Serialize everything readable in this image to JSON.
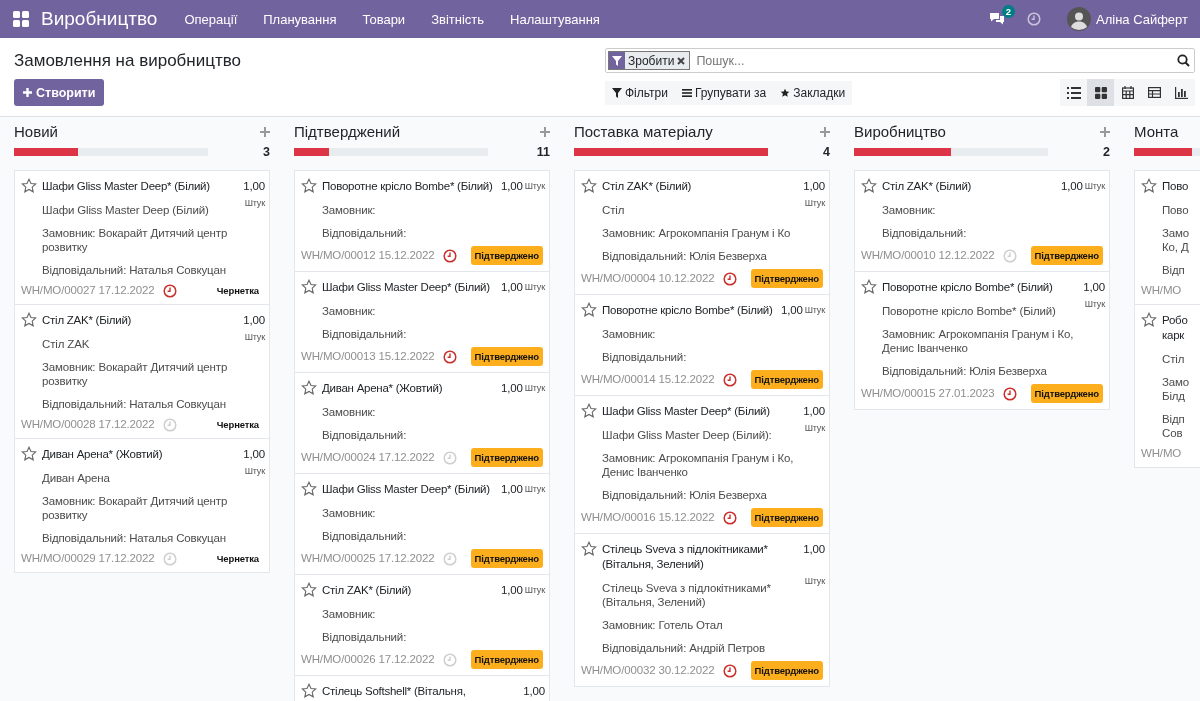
{
  "navbar": {
    "app_title": "Виробництво",
    "menu": [
      "Операції",
      "Планування",
      "Товари",
      "Звітність",
      "Налаштування"
    ],
    "messages_count": "2",
    "user_name": "Аліна Сайферт"
  },
  "control_panel": {
    "title": "Замовлення на виробництво",
    "create_button": "Створити",
    "search": {
      "facets": [
        {
          "label": "Зробити"
        }
      ],
      "placeholder": "Пошук..."
    },
    "filter_buttons": [
      {
        "kind": "filter",
        "label": "Фільтри"
      },
      {
        "kind": "group",
        "label": "Групувати за"
      },
      {
        "kind": "favorite",
        "label": "Закладки"
      }
    ],
    "views": [
      {
        "kind": "list",
        "selected": false
      },
      {
        "kind": "kanban",
        "selected": true
      },
      {
        "kind": "calendar",
        "selected": false
      },
      {
        "kind": "pivot",
        "selected": false
      },
      {
        "kind": "graph",
        "selected": false
      }
    ]
  },
  "columns": [
    {
      "title": "Новий",
      "count": "3",
      "level": 0.33,
      "cards": [
        {
          "name": "Шафи Gliss Master Deep* (Білий)",
          "quantity": "1,00",
          "uom": "Штук",
          "product": "Шафи Gliss Master Deep (Білий)",
          "customer": "Замовник: Вокарайт Дитячий центр розвитку",
          "responsible": "Відповідальний: Наталья Совкуцан",
          "reference": "WH/MO/00027 17.12.2022",
          "overdue": true,
          "status": {
            "kind": "draft",
            "label": "Чернетка"
          }
        },
        {
          "name": "Стіл ZAK* (Білий)",
          "quantity": "1,00",
          "uom": "Штук",
          "product": "Стіл ZAK",
          "customer": "Замовник: Вокарайт Дитячий центр розвитку",
          "responsible": "Відповідальний: Наталья Совкуцан",
          "reference": "WH/MO/00028 17.12.2022",
          "overdue": false,
          "status": {
            "kind": "draft",
            "label": "Чернетка"
          }
        },
        {
          "name": "Диван Арена* (Жовтий)",
          "quantity": "1,00",
          "uom": "Штук",
          "product": "Диван Арена",
          "customer": "Замовник: Вокарайт Дитячий центр розвитку",
          "responsible": "Відповідальний: Наталья Совкуцан",
          "reference": "WH/MO/00029 17.12.2022",
          "overdue": false,
          "status": {
            "kind": "draft",
            "label": "Чернетка"
          }
        }
      ]
    },
    {
      "title": "Підтверджений",
      "count": "11",
      "level": 0.18,
      "cards": [
        {
          "name": "Поворотне крісло Bombe* (Білий)",
          "quantity": "1,00",
          "uom": "Штук",
          "customer": "Замовник:",
          "responsible": "Відповідальний:",
          "reference": "WH/MO/00012 15.12.2022",
          "overdue": true,
          "status": {
            "kind": "confirmed",
            "label": "Підтверджено"
          }
        },
        {
          "name": "Шафи Gliss Master Deep* (Білий)",
          "quantity": "1,00",
          "uom": "Штук",
          "customer": "Замовник:",
          "responsible": "Відповідальний:",
          "reference": "WH/MO/00013 15.12.2022",
          "overdue": true,
          "status": {
            "kind": "confirmed",
            "label": "Підтверджено"
          }
        },
        {
          "name": "Диван Арена* (Жовтий)",
          "quantity": "1,00",
          "uom": "Штук",
          "customer": "Замовник:",
          "responsible": "Відповідальний:",
          "reference": "WH/MO/00024 17.12.2022",
          "overdue": false,
          "status": {
            "kind": "confirmed",
            "label": "Підтверджено"
          }
        },
        {
          "name": "Шафи Gliss Master Deep* (Білий)",
          "quantity": "1,00",
          "uom": "Штук",
          "customer": "Замовник:",
          "responsible": "Відповідальний:",
          "reference": "WH/MO/00025 17.12.2022",
          "overdue": false,
          "status": {
            "kind": "confirmed",
            "label": "Підтверджено"
          }
        },
        {
          "name": "Стіл ZAK* (Білий)",
          "quantity": "1,00",
          "uom": "Штук",
          "customer": "Замовник:",
          "responsible": "Відповідальний:",
          "reference": "WH/MO/00026 17.12.2022",
          "overdue": false,
          "status": {
            "kind": "confirmed",
            "label": "Підтверджено"
          }
        },
        {
          "name": "Стілець Softshell* (Вітальня,",
          "quantity": "1,00"
        }
      ]
    },
    {
      "title": "Поставка матеріалу",
      "count": "4",
      "level": 1,
      "cards": [
        {
          "name": "Стіл ZAK* (Білий)",
          "quantity": "1,00",
          "uom": "Штук",
          "product": "Стіл",
          "customer": "Замовник: Агрокомпанія Гранум і Ко",
          "responsible": "Відповідальний: Юлія Безверха",
          "reference": "WH/MO/00004 10.12.2022",
          "overdue": true,
          "status": {
            "kind": "confirmed",
            "label": "Підтверджено"
          }
        },
        {
          "name": "Поворотне крісло Bombe* (Білий)",
          "quantity": "1,00",
          "uom": "Штук",
          "customer": "Замовник:",
          "responsible": "Відповідальний:",
          "reference": "WH/MO/00014 15.12.2022",
          "overdue": true,
          "status": {
            "kind": "confirmed",
            "label": "Підтверджено"
          }
        },
        {
          "name": "Шафи Gliss Master Deep* (Білий)",
          "quantity": "1,00",
          "uom": "Штук",
          "product": "Шафи Gliss Master Deep (Білий):",
          "customer": "Замовник: Агрокомпанія Гранум і Ко, Денис Іванченко",
          "responsible": "Відповідальний: Юлія Безверха",
          "reference": "WH/MO/00016 15.12.2022",
          "overdue": true,
          "status": {
            "kind": "confirmed",
            "label": "Підтверджено"
          }
        },
        {
          "name": "Стілець Sveva з підлокітниками* (Вітальня, Зелений)",
          "quantity": "1,00",
          "uom": "Штук",
          "product": "Стілець Sveva з підлокітниками* (Вітальня, Зелений)",
          "customer": "Замовник: Готель Отал",
          "responsible": "Відповідальний: Андрій Петров",
          "reference": "WH/MO/00032 30.12.2022",
          "overdue": true,
          "status": {
            "kind": "confirmed",
            "label": "Підтверджено"
          }
        }
      ]
    },
    {
      "title": "Виробництво",
      "count": "2",
      "level": 0.5,
      "cards": [
        {
          "name": "Стіл ZAK* (Білий)",
          "quantity": "1,00",
          "uom": "Штук",
          "customer": "Замовник:",
          "responsible": "Відповідальний:",
          "reference": "WH/MO/00010 12.12.2022",
          "overdue": false,
          "status": {
            "kind": "confirmed",
            "label": "Підтверджено"
          }
        },
        {
          "name": "Поворотне крісло Bombe* (Білий)",
          "quantity": "1,00",
          "uom": "Штук",
          "product": "Поворотне крісло Bombe* (Білий)",
          "customer": "Замовник: Агрокомпанія Гранум і Ко, Денис Іванченко",
          "responsible": "Відповідальний: Юлія Безверха",
          "reference": "WH/MO/00015 27.01.2023",
          "overdue": true,
          "status": {
            "kind": "confirmed",
            "label": "Підтверджено"
          }
        }
      ]
    },
    {
      "title": "Монта",
      "level": 0.3,
      "cards": [
        {
          "name": "Пово",
          "product": "Пово",
          "customer": "Замо\nКо, Д",
          "responsible": "Відп",
          "reference": "WH/MO"
        },
        {
          "name": "Робо\nкарк",
          "product": "Стіл",
          "customer": "Замо\nБілд",
          "responsible": "Відп\nСов",
          "reference": "WH/MO"
        }
      ]
    }
  ]
}
